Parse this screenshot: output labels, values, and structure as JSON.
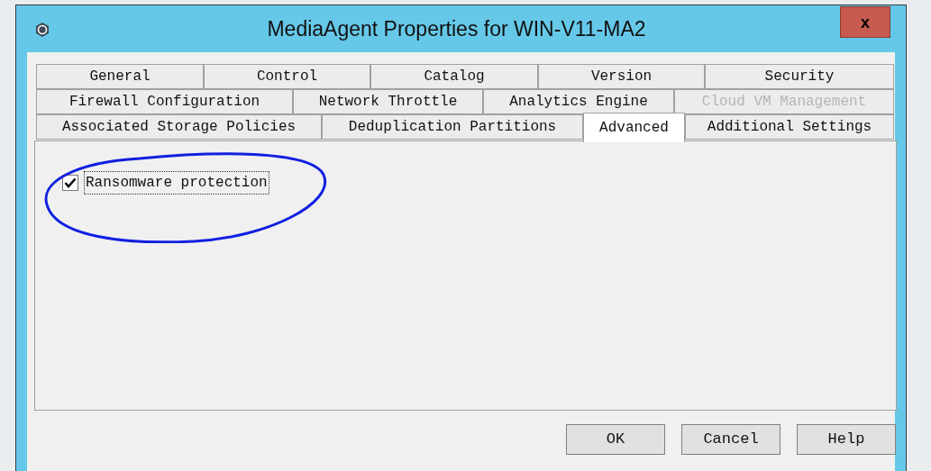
{
  "window": {
    "title": "MediaAgent Properties for WIN-V11-MA2",
    "close": "x"
  },
  "tab_rows": [
    [
      {
        "label": "General",
        "selected": false,
        "disabled": false
      },
      {
        "label": "Control",
        "selected": false,
        "disabled": false
      },
      {
        "label": "Catalog",
        "selected": false,
        "disabled": false
      },
      {
        "label": "Version",
        "selected": false,
        "disabled": false
      },
      {
        "label": "Security",
        "selected": false,
        "disabled": false
      }
    ],
    [
      {
        "label": "Firewall Configuration",
        "selected": false,
        "disabled": false
      },
      {
        "label": "Network Throttle",
        "selected": false,
        "disabled": false
      },
      {
        "label": "Analytics Engine",
        "selected": false,
        "disabled": false
      },
      {
        "label": "Cloud VM Management",
        "selected": false,
        "disabled": true
      }
    ],
    [
      {
        "label": "Associated Storage Policies",
        "selected": false,
        "disabled": false
      },
      {
        "label": "Deduplication Partitions",
        "selected": false,
        "disabled": false
      },
      {
        "label": "Advanced",
        "selected": true,
        "disabled": false
      },
      {
        "label": "Additional Settings",
        "selected": false,
        "disabled": false
      }
    ]
  ],
  "checkbox": {
    "label": "Ransomware protection",
    "checked": true
  },
  "buttons": [
    "OK",
    "Cancel",
    "Help"
  ]
}
